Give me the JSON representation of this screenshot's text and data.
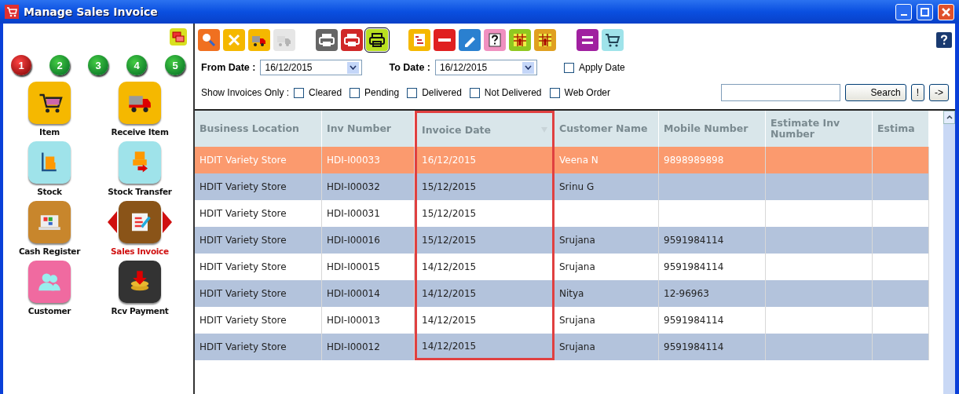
{
  "window": {
    "title": "Manage Sales Invoice"
  },
  "steps": [
    {
      "label": "1",
      "selected": true
    },
    {
      "label": "2",
      "selected": false
    },
    {
      "label": "3",
      "selected": false
    },
    {
      "label": "4",
      "selected": false
    },
    {
      "label": "5",
      "selected": false
    }
  ],
  "nav": [
    {
      "label": "Item",
      "kind": "cart",
      "selected": false
    },
    {
      "label": "Receive Item",
      "kind": "truck",
      "selected": false
    },
    {
      "label": "Stock",
      "kind": "trolley",
      "selected": false
    },
    {
      "label": "Stock Transfer",
      "kind": "transfer",
      "selected": false
    },
    {
      "label": "Cash Register",
      "kind": "register",
      "selected": false
    },
    {
      "label": "Sales Invoice",
      "kind": "invoice",
      "selected": true
    },
    {
      "label": "Customer",
      "kind": "people",
      "selected": false
    },
    {
      "label": "Rcv Payment",
      "kind": "payment",
      "selected": false
    }
  ],
  "toolbar": [
    {
      "kind": "search",
      "disabled": false,
      "selected": false
    },
    {
      "kind": "close",
      "disabled": false,
      "selected": false
    },
    {
      "kind": "truck",
      "disabled": false,
      "selected": false
    },
    {
      "kind": "truck",
      "disabled": true,
      "selected": false
    },
    {
      "kind": "gap"
    },
    {
      "kind": "print-grey",
      "disabled": false,
      "selected": false
    },
    {
      "kind": "print-red",
      "disabled": false,
      "selected": false
    },
    {
      "kind": "print-lime",
      "disabled": false,
      "selected": true
    },
    {
      "kind": "gap"
    },
    {
      "kind": "doc",
      "disabled": false,
      "selected": false
    },
    {
      "kind": "minus",
      "disabled": false,
      "selected": false
    },
    {
      "kind": "pencil",
      "disabled": false,
      "selected": false
    },
    {
      "kind": "question",
      "disabled": false,
      "selected": false
    },
    {
      "kind": "grid-lime",
      "disabled": false,
      "selected": false
    },
    {
      "kind": "grid-gold",
      "disabled": false,
      "selected": false
    },
    {
      "kind": "gap"
    },
    {
      "kind": "equals",
      "disabled": false,
      "selected": false
    },
    {
      "kind": "cart",
      "disabled": false,
      "selected": false
    }
  ],
  "from_date": {
    "label": "From Date :",
    "value": "16/12/2015"
  },
  "to_date": {
    "label": "To Date :",
    "value": "16/12/2015"
  },
  "apply_date": {
    "label": "Apply Date",
    "checked": false
  },
  "show_only": {
    "label": "Show Invoices Only :",
    "options": [
      {
        "label": "Cleared",
        "checked": false
      },
      {
        "label": "Pending",
        "checked": false
      },
      {
        "label": "Delivered",
        "checked": false
      },
      {
        "label": "Not Delivered",
        "checked": false
      },
      {
        "label": "Web Order",
        "checked": false
      }
    ]
  },
  "search": {
    "button": "Search",
    "extra_buttons": [
      "!",
      "->"
    ]
  },
  "table": {
    "columns": [
      "Business Location",
      "Inv Number",
      "Invoice Date",
      "Customer Name",
      "Mobile Number",
      "Estimate Inv Number",
      "Estima"
    ],
    "rows": [
      {
        "selected": true,
        "cells": [
          "HDIT Variety Store",
          "HDI-I00033",
          "16/12/2015",
          "Veena N",
          "9898989898",
          "",
          ""
        ]
      },
      {
        "selected": false,
        "cells": [
          "HDIT Variety Store",
          "HDI-I00032",
          "15/12/2015",
          "Srinu G",
          "",
          "",
          ""
        ]
      },
      {
        "selected": false,
        "cells": [
          "HDIT Variety Store",
          "HDI-I00031",
          "15/12/2015",
          "",
          "",
          "",
          ""
        ]
      },
      {
        "selected": false,
        "cells": [
          "HDIT Variety Store",
          "HDI-I00016",
          "15/12/2015",
          "Srujana",
          "9591984114",
          "",
          ""
        ]
      },
      {
        "selected": false,
        "cells": [
          "HDIT Variety Store",
          "HDI-I00015",
          "14/12/2015",
          "Srujana",
          "9591984114",
          "",
          ""
        ]
      },
      {
        "selected": false,
        "cells": [
          "HDIT Variety Store",
          "HDI-I00014",
          "14/12/2015",
          "Nitya",
          "12-96963",
          "",
          ""
        ]
      },
      {
        "selected": false,
        "cells": [
          "HDIT Variety Store",
          "HDI-I00013",
          "14/12/2015",
          "Srujana",
          "9591984114",
          "",
          ""
        ]
      },
      {
        "selected": false,
        "cells": [
          "HDIT Variety Store",
          "HDI-I00012",
          "14/12/2015",
          "Srujana",
          "9591984114",
          "",
          ""
        ]
      }
    ]
  }
}
